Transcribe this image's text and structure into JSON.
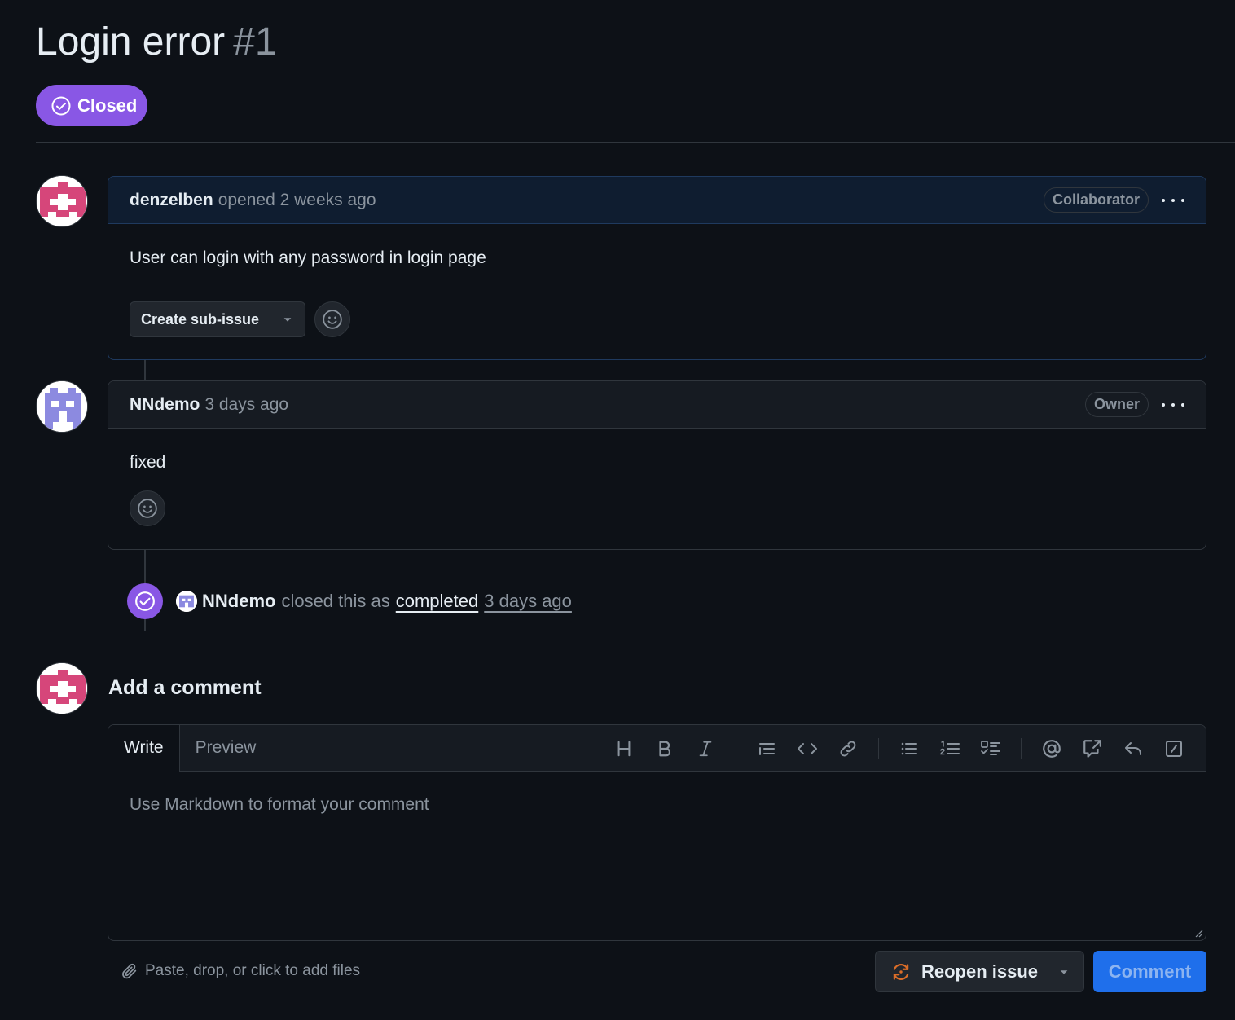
{
  "issue": {
    "title": "Login error",
    "number": "#1",
    "state": "Closed",
    "state_color": "#8957e5"
  },
  "comments": [
    {
      "author": "denzelben",
      "meta": "opened 2 weeks ago",
      "role": "Collaborator",
      "body": "User can login with any password in login page",
      "create_sub_issue_label": "Create sub-issue",
      "avatar_color": "#d6467a"
    },
    {
      "author": "NNdemo",
      "meta": "3 days ago",
      "role": "Owner",
      "body": "fixed",
      "avatar_color": "#8c8ae0"
    }
  ],
  "event": {
    "actor": "NNdemo",
    "action": "closed this as",
    "reason": "completed",
    "time": "3 days ago"
  },
  "composer": {
    "title": "Add a comment",
    "tabs": [
      "Write",
      "Preview"
    ],
    "placeholder": "Use Markdown to format your comment",
    "attach_hint": "Paste, drop, or click to add files",
    "reopen_label": "Reopen issue",
    "comment_label": "Comment"
  },
  "icons": [
    "check-circle-icon",
    "triangle-down-icon",
    "smiley-icon",
    "heading-icon",
    "bold-icon",
    "italic-icon",
    "quote-icon",
    "code-icon",
    "link-icon",
    "unordered-list-icon",
    "ordered-list-icon",
    "task-list-icon",
    "mention-icon",
    "cross-reference-icon",
    "saved-reply-icon",
    "slash-command-icon",
    "paperclip-icon",
    "issue-reopened-icon"
  ],
  "colors": {
    "background": "#0d1117",
    "primary_button": "#1f6feb",
    "reopen_icon": "#db6d28"
  }
}
